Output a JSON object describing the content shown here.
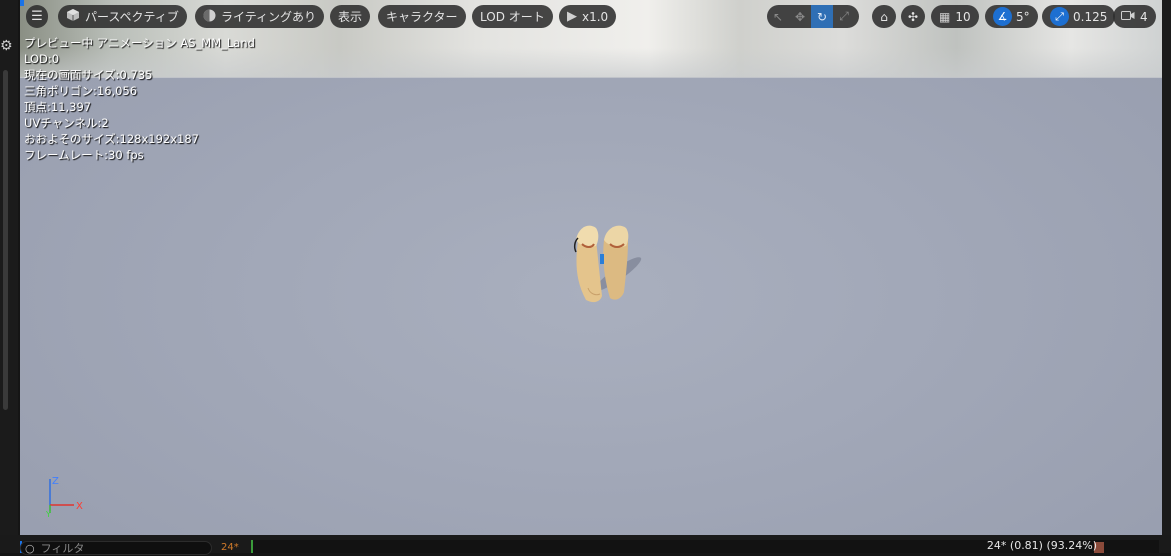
{
  "toolbar": {
    "menu_icon": "hamburger-icon",
    "perspective": {
      "label": "パースペクティブ",
      "icon": "cube-icon"
    },
    "lighting": {
      "label": "ライティングあり",
      "icon": "lighting-sphere-icon"
    },
    "show": {
      "label": "表示"
    },
    "character": {
      "label": "キャラクター"
    },
    "lod": {
      "label": "LOD オート"
    },
    "playback": {
      "label": "x1.0",
      "icon": "play-icon"
    },
    "transform_tools": [
      "select-icon",
      "translate-icon",
      "rotate-icon",
      "scale-icon"
    ],
    "active_tool": "rotate-icon",
    "grid_snap": {
      "value": "10",
      "icon": "grid-icon"
    },
    "angle_snap": {
      "value": "5°",
      "icon": "angle-icon"
    },
    "scale_snap": {
      "value": "0.125",
      "icon": "scale-snap-icon"
    },
    "camera_speed": {
      "value": "4",
      "icon": "camera-icon"
    },
    "accent_color": "#1d6fd1"
  },
  "stats": [
    "プレビュー中 アニメーション AS_MM_Land",
    "LOD:0",
    "現在の画面サイズ:0.735",
    "三角ポリゴン:16,056",
    "頂点:11,397",
    "UVチャンネル:2",
    "おおよそのサイズ:128x192x187",
    "フレームレート:30 fps"
  ],
  "gizmo": {
    "z": "Z",
    "x": "X",
    "y": "Y"
  },
  "timeline": {
    "filter_placeholder": "フィルタ",
    "frame_label": "24*",
    "readout": "24* (0.81) (93.24%)"
  }
}
